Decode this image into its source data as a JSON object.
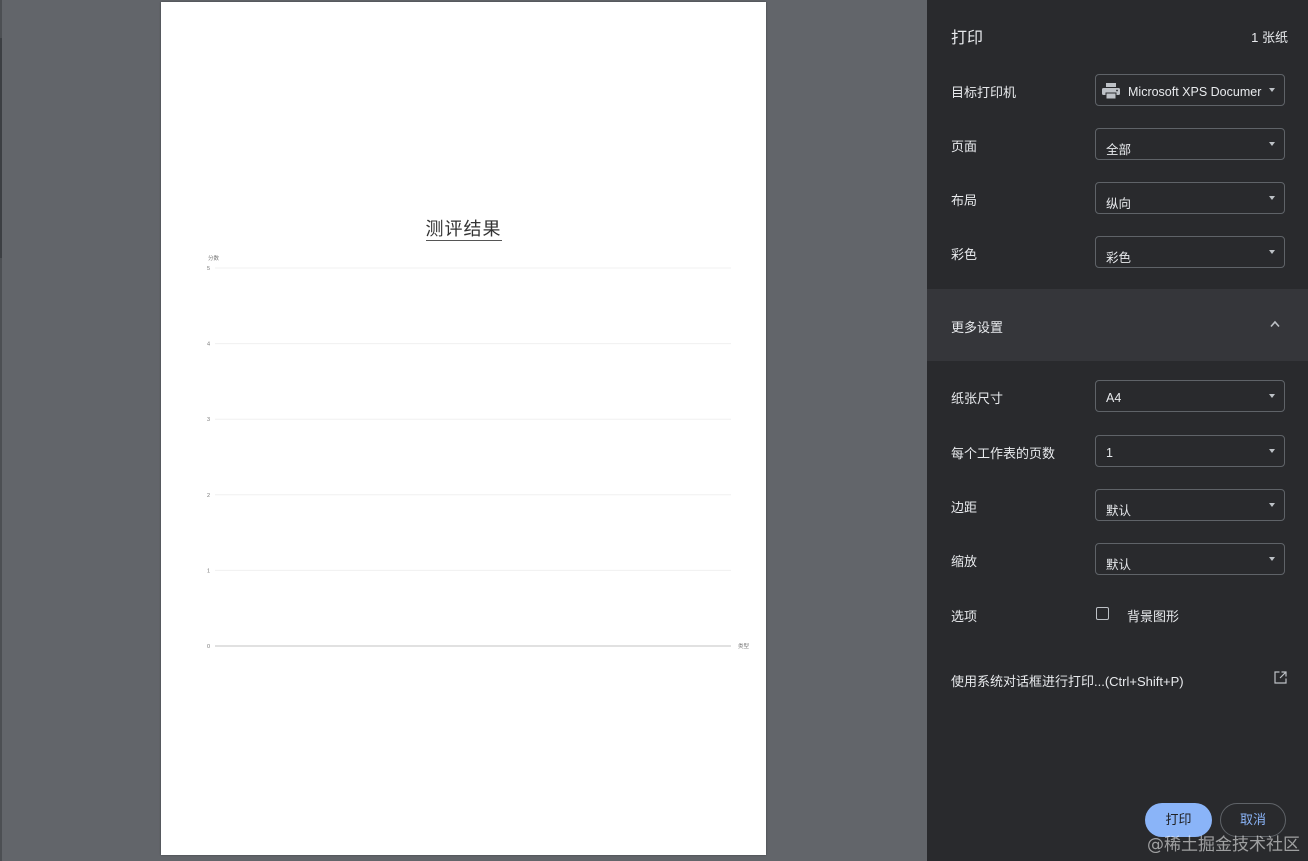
{
  "preview": {
    "document_title": "测评结果"
  },
  "chart_data": {
    "type": "bar",
    "categories": [],
    "values": [],
    "ylabel": "分数",
    "xlabel": "类型",
    "ylim": [
      0,
      5
    ],
    "yticks": [
      "0",
      "1",
      "2",
      "3",
      "4",
      "5"
    ],
    "grid": true
  },
  "panel": {
    "title": "打印",
    "sheet_count": "1 张纸",
    "destination": {
      "label": "目标打印机",
      "value": "Microsoft XPS Documer",
      "icon": "printer-icon"
    },
    "pages": {
      "label": "页面",
      "value": "全部"
    },
    "layout": {
      "label": "布局",
      "value": "纵向"
    },
    "color": {
      "label": "彩色",
      "value": "彩色"
    },
    "more_settings": {
      "label": "更多设置",
      "icon": "chevron-up-icon"
    },
    "paper_size": {
      "label": "纸张尺寸",
      "value": "A4"
    },
    "pages_per_sheet": {
      "label": "每个工作表的页数",
      "value": "1"
    },
    "margins": {
      "label": "边距",
      "value": "默认"
    },
    "scale": {
      "label": "缩放",
      "value": "默认"
    },
    "options": {
      "label": "选项",
      "checkbox_label": "背景图形",
      "checked": false
    },
    "system_dialog": {
      "label": "使用系统对话框进行打印...(Ctrl+Shift+P)",
      "icon": "open-in-new-icon"
    },
    "print_button": "打印",
    "cancel_button": "取消",
    "accent_color": "#8ab4f8"
  },
  "watermark": "@稀土掘金技术社区"
}
